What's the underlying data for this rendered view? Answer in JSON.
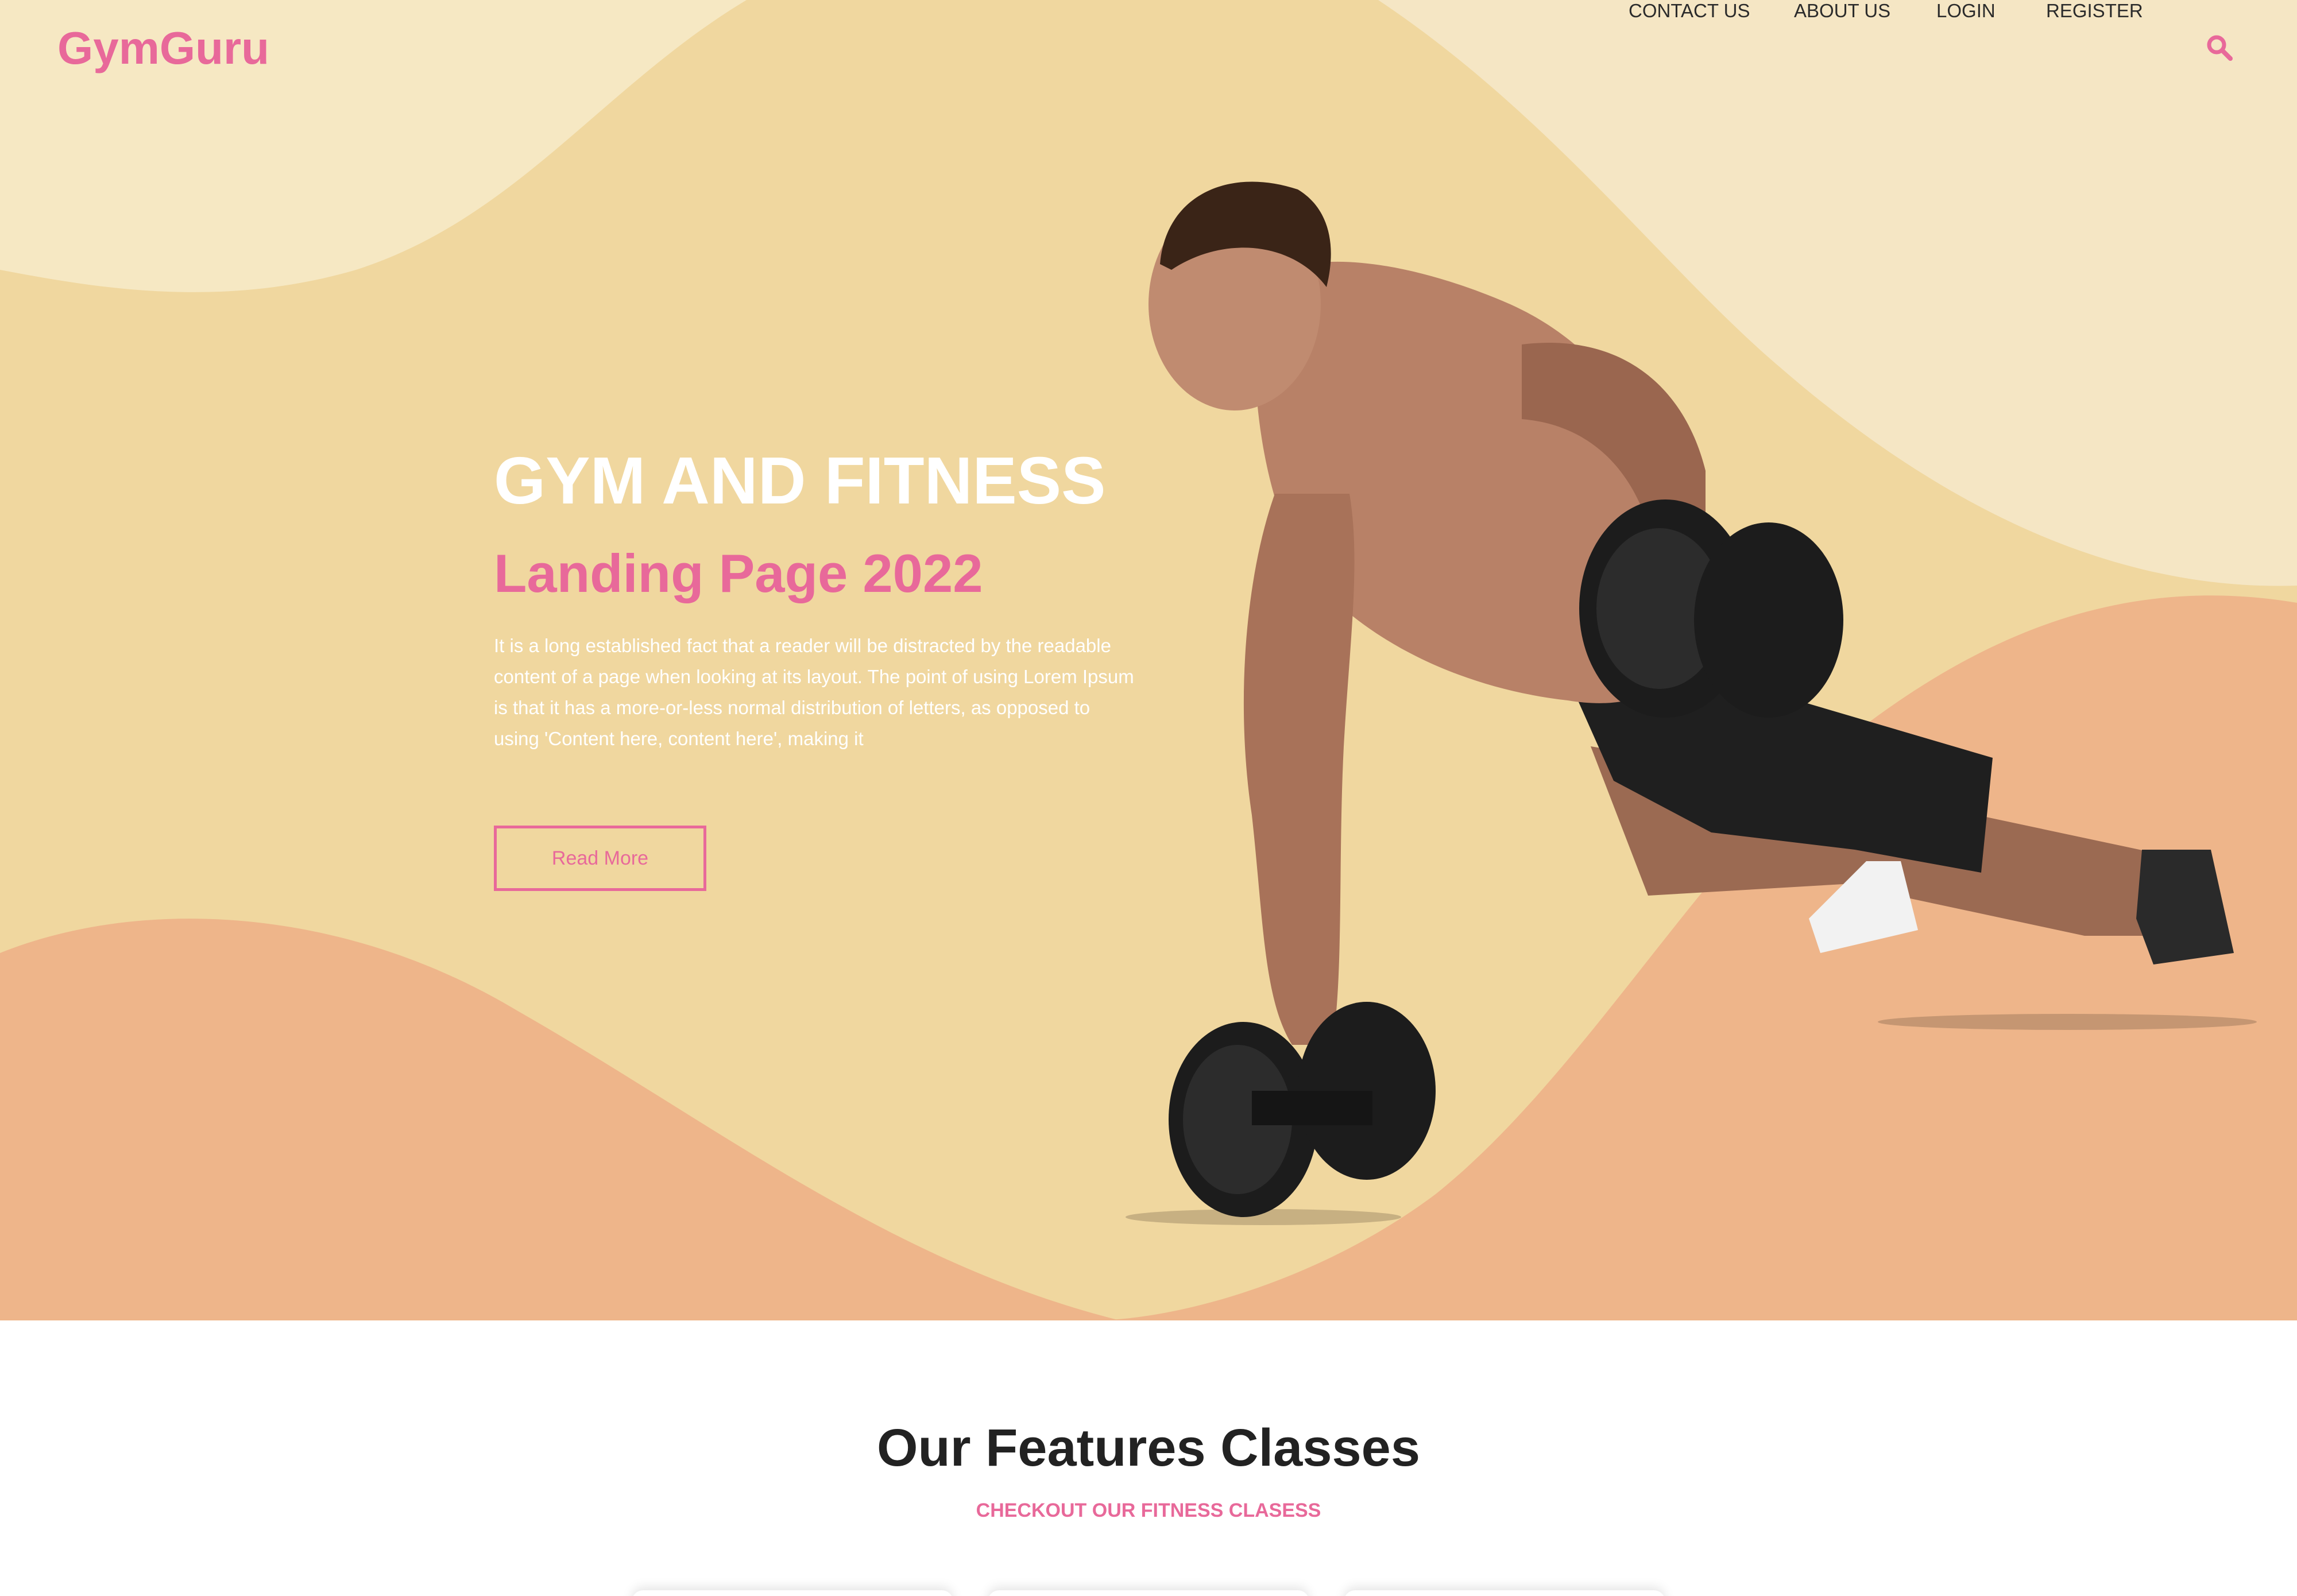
{
  "brand": {
    "name": "GymGuru"
  },
  "nav": {
    "items": [
      {
        "label": "CONTACT US"
      },
      {
        "label": "ABOUT US"
      },
      {
        "label": "LOGIN"
      },
      {
        "label": "REGISTER"
      }
    ],
    "search_icon": "search-icon"
  },
  "hero": {
    "title": "GYM AND FITNESS",
    "subtitle": "Landing Page 2022",
    "text": "It is a long established fact that a reader will be distracted by the readable content of a page when looking at its layout. The point of using Lorem Ipsum is that it has a more-or-less normal distribution of letters, as opposed to using 'Content here, content here', making it",
    "button_label": "Read More"
  },
  "features": {
    "title": "Our Features Classes",
    "subtitle": "CHECKOUT OUR FITNESS CLASESS"
  },
  "colors": {
    "accent": "#e8699a",
    "hero_base": "#f0d79f",
    "hero_light": "#f6e8c3",
    "hero_peach": "#eeb58a"
  }
}
